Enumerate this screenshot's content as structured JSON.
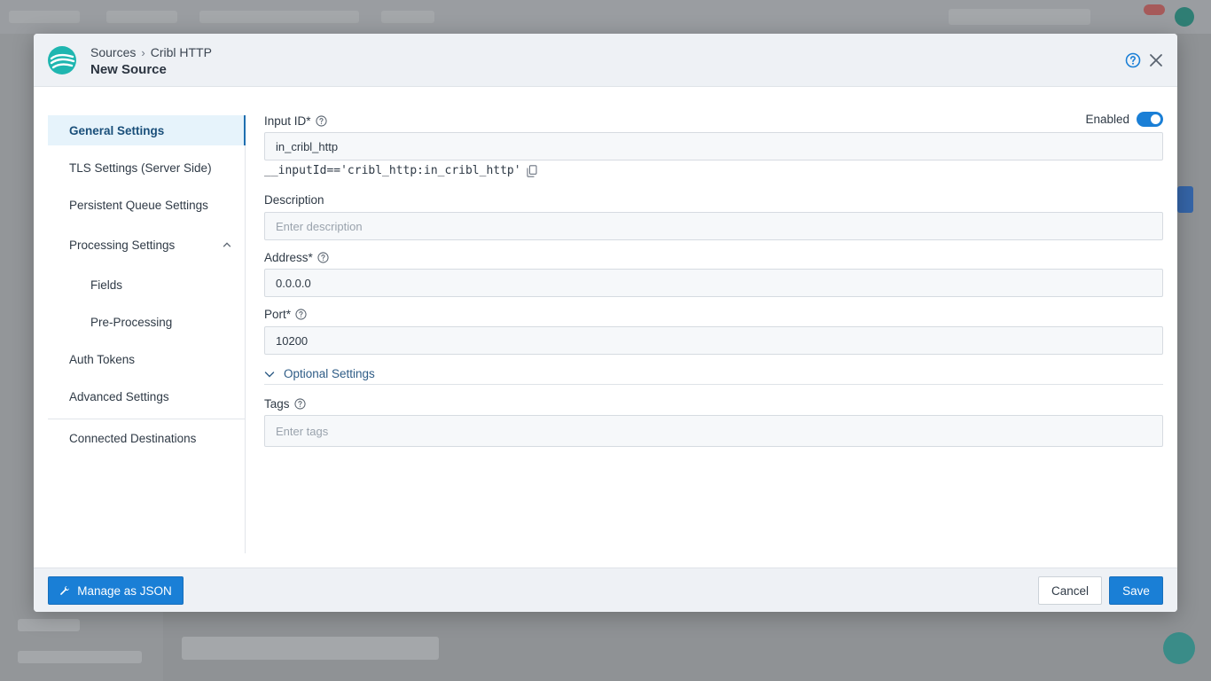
{
  "header": {
    "breadcrumb": [
      "Sources",
      "Cribl HTTP"
    ],
    "title": "New Source"
  },
  "nav": {
    "items": [
      {
        "label": "General Settings",
        "active": true
      },
      {
        "label": "TLS Settings (Server Side)"
      },
      {
        "label": "Persistent Queue Settings"
      },
      {
        "label": "Processing Settings",
        "expanded": true
      },
      {
        "label": "Fields",
        "sub": true
      },
      {
        "label": "Pre-Processing",
        "sub": true
      },
      {
        "label": "Auth Tokens"
      },
      {
        "label": "Advanced Settings"
      },
      {
        "label": "Connected Destinations"
      }
    ]
  },
  "form": {
    "input_id": {
      "label": "Input ID*",
      "value": "in_cribl_http",
      "expression": "__inputId=='cribl_http:in_cribl_http'"
    },
    "enabled": {
      "label": "Enabled",
      "on": true
    },
    "description": {
      "label": "Description",
      "placeholder": "Enter description"
    },
    "address": {
      "label": "Address*",
      "value": "0.0.0.0"
    },
    "port": {
      "label": "Port*",
      "value": "10200"
    },
    "optional": {
      "label": "Optional Settings"
    },
    "tags": {
      "label": "Tags",
      "placeholder": "Enter tags"
    }
  },
  "footer": {
    "manage_json": "Manage as JSON",
    "cancel": "Cancel",
    "save": "Save"
  },
  "colors": {
    "accent": "#1a7fd6",
    "active_nav_bg": "#e6f3fb",
    "brand_teal": "#1fb6b0"
  }
}
